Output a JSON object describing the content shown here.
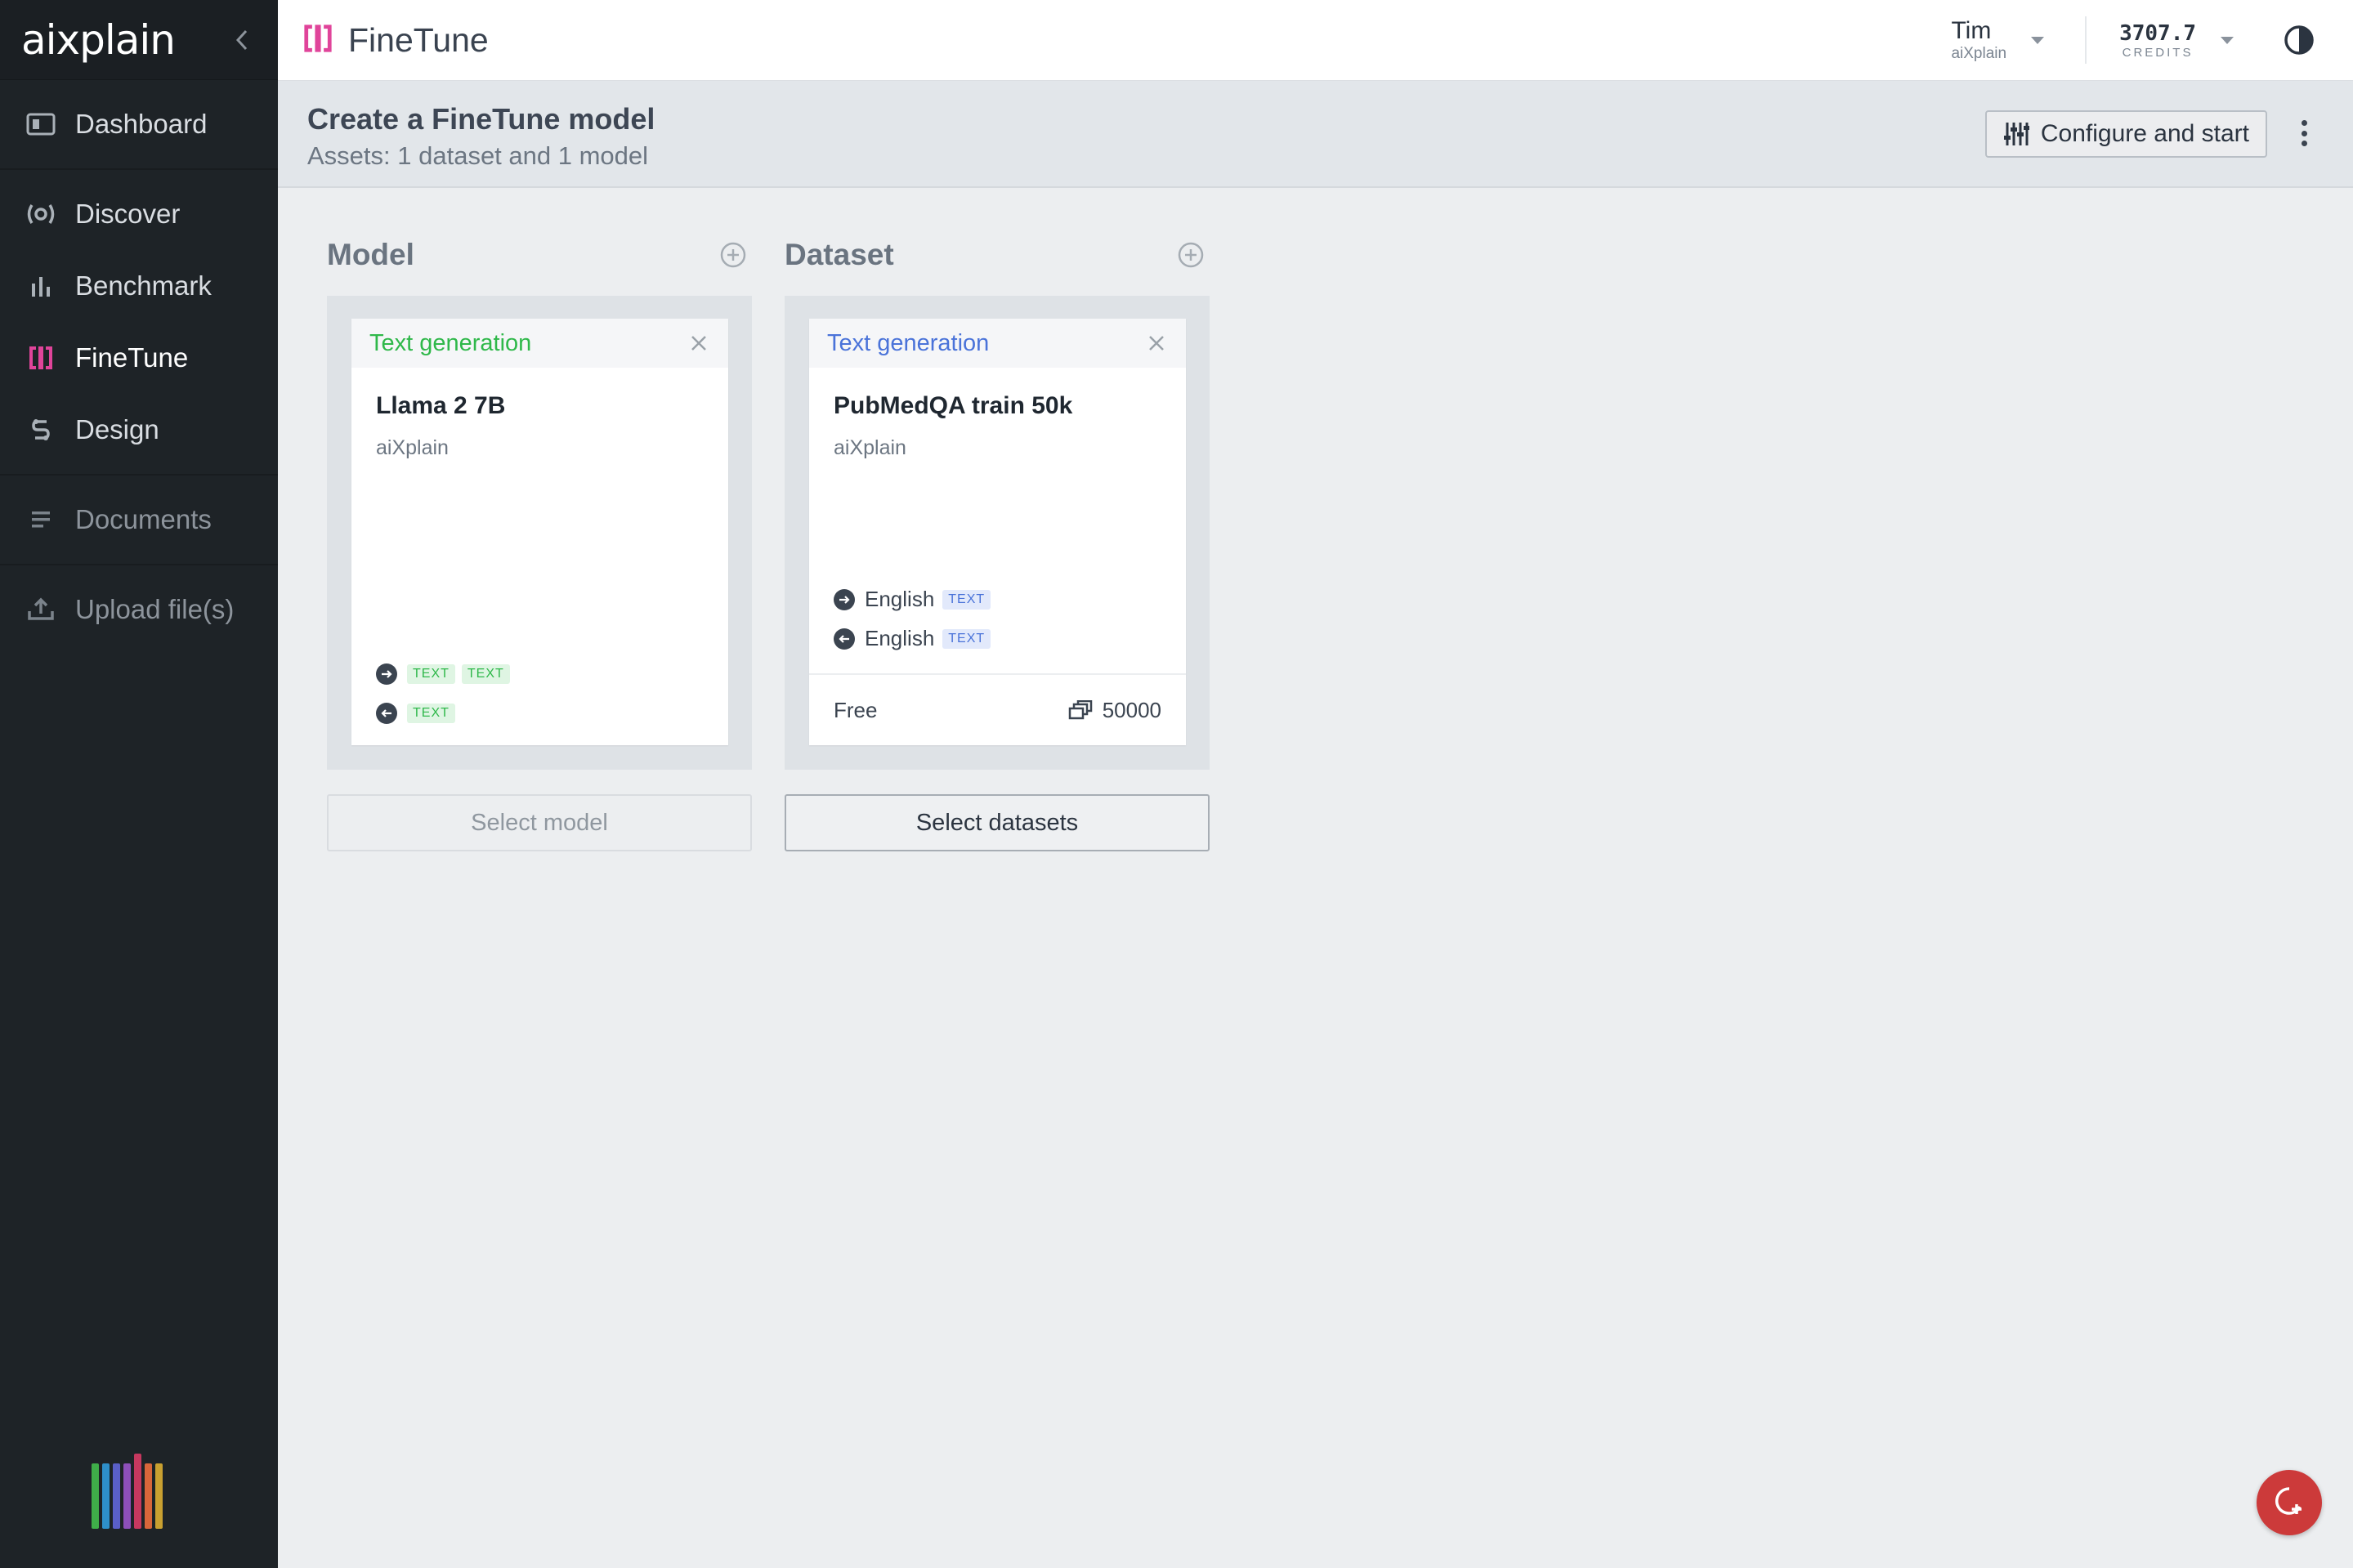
{
  "sidebar": {
    "logo": "aixplain",
    "items": [
      {
        "label": "Dashboard",
        "icon": "dashboard-icon"
      },
      {
        "label": "Discover",
        "icon": "discover-icon"
      },
      {
        "label": "Benchmark",
        "icon": "benchmark-icon"
      },
      {
        "label": "FineTune",
        "icon": "finetune-icon",
        "active": true
      },
      {
        "label": "Design",
        "icon": "design-icon"
      },
      {
        "label": "Documents",
        "icon": "documents-icon"
      },
      {
        "label": "Upload file(s)",
        "icon": "upload-icon"
      }
    ]
  },
  "topbar": {
    "app_title": "FineTune",
    "user_name": "Tim",
    "user_org": "aiXplain",
    "credits_value": "3707.7",
    "credits_label": "CREDITS"
  },
  "header": {
    "title": "Create a FineTune model",
    "subtitle": "Assets: 1 dataset and 1 model",
    "configure_label": "Configure and start"
  },
  "model_column": {
    "title": "Model",
    "card": {
      "function": "Text generation",
      "name": "Llama 2 7B",
      "org": "aiXplain",
      "input_tags": [
        "TEXT",
        "TEXT"
      ],
      "output_tags": [
        "TEXT"
      ]
    },
    "select_label": "Select model"
  },
  "dataset_column": {
    "title": "Dataset",
    "card": {
      "function": "Text generation",
      "name": "PubMedQA train 50k",
      "org": "aiXplain",
      "input_language": "English",
      "input_tag": "TEXT",
      "output_language": "English",
      "output_tag": "TEXT",
      "price": "Free",
      "count": "50000"
    },
    "select_label": "Select datasets"
  },
  "colors": {
    "sidebar_bg": "#1e2327",
    "accent_pink": "#e0449a",
    "green": "#2fb84a",
    "blue": "#4a73d9",
    "fab_red": "#cc3a3a"
  }
}
